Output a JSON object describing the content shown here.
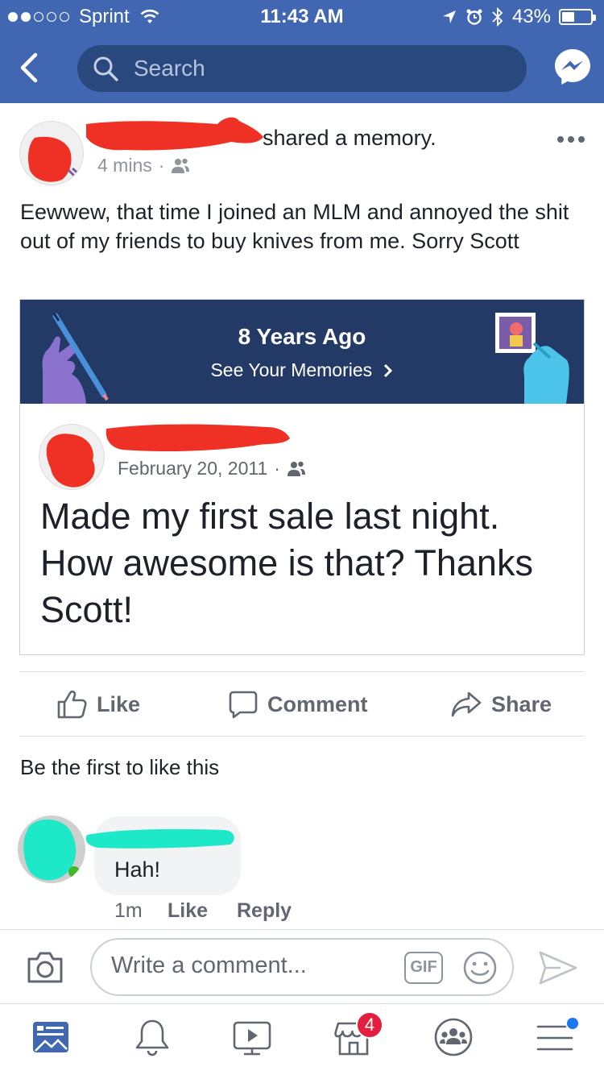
{
  "status_bar": {
    "carrier": "Sprint",
    "time": "11:43 AM",
    "battery": "43%",
    "battery_level": 0.43,
    "signal_bars_filled": 2,
    "signal_bars_total": 5
  },
  "nav": {
    "search_placeholder": "Search",
    "icons": [
      "back-chevron-icon",
      "search-icon",
      "messenger-icon"
    ]
  },
  "post": {
    "action_text": "shared a memory.",
    "time_ago": "4 mins",
    "audience_icon": "friends-icon",
    "body": "Eewwew, that time I joined an MLM and annoyed the shit out of my friends to buy knives from me. Sorry Scott"
  },
  "memory": {
    "title": "8 Years Ago",
    "link": "See Your Memories",
    "link_icon": "chevron-right-icon",
    "original_post": {
      "date": "February 20, 2011",
      "audience_icon": "friends-icon",
      "text": "Made my first sale last night. How awesome is that? Thanks Scott!"
    }
  },
  "actions": {
    "like": "Like",
    "comment": "Comment",
    "share": "Share"
  },
  "likes_summary": "Be the first to like this",
  "comment": {
    "text": "Hah!",
    "time": "1m",
    "like": "Like",
    "reply": "Reply"
  },
  "composer": {
    "placeholder": "Write a comment...",
    "gif": "GIF"
  },
  "tab_bar": {
    "marketplace_badge": "4",
    "tabs": [
      "news-feed-icon",
      "notifications-icon",
      "watch-icon",
      "marketplace-icon",
      "groups-icon",
      "menu-icon"
    ]
  },
  "colors": {
    "header_blue": "#4267b2",
    "search_blue": "#29487d",
    "memory_banner": "#233966",
    "redaction_red": "#ee3124",
    "redaction_teal": "#1de9c8"
  }
}
